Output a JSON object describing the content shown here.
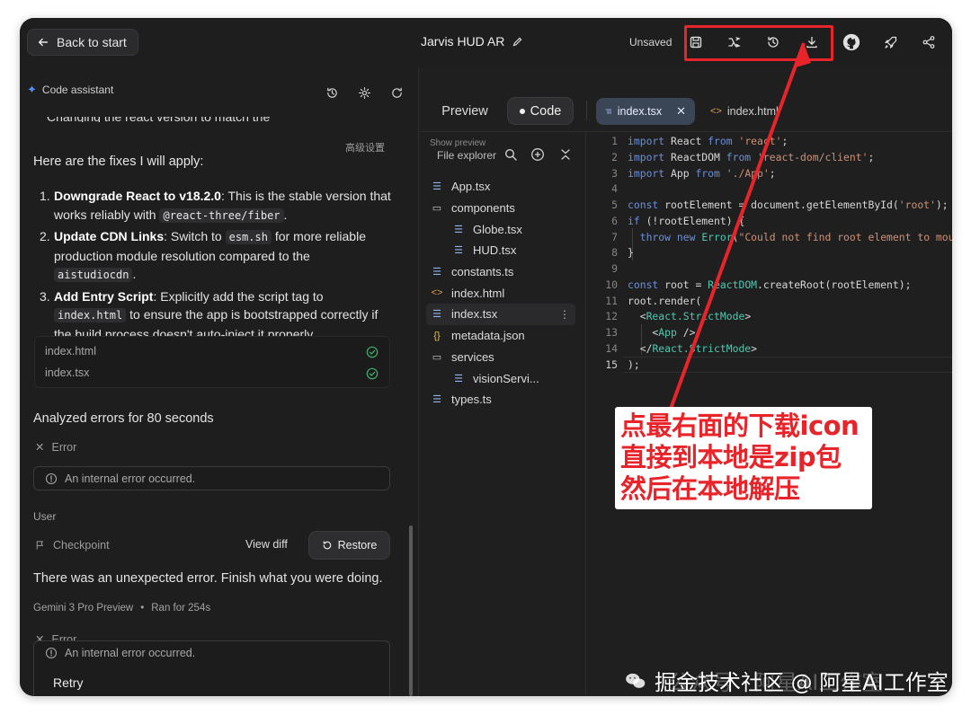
{
  "header": {
    "back_label": "Back to start",
    "title": "Jarvis HUD AR",
    "status": "Unsaved",
    "toolbar_icons": [
      "save-icon",
      "share-icon",
      "history-icon",
      "download-icon"
    ],
    "right_icons": [
      "github-icon",
      "deploy-icon",
      "share-nodes-icon"
    ]
  },
  "assistant": {
    "title": "Code assistant",
    "advanced_settings": "高级设置",
    "intro": "Here are the fixes I will apply:",
    "fixes": [
      {
        "num": "1.",
        "bold": "Downgrade React to v18.2.0",
        "text1": ": This is the stable version that works reliably with ",
        "code1": "@react-three/fiber",
        "text2": "."
      },
      {
        "num": "2.",
        "bold": "Update CDN Links",
        "text1": ": Switch to ",
        "code1": "esm.sh",
        "text2": " for more reliable production module resolution compared to the ",
        "code2": "aistudiocdn",
        "text3": "."
      },
      {
        "num": "3.",
        "bold": "Add Entry Script",
        "text1": ": Explicitly add the script tag to ",
        "code1": "index.html",
        "text2": " to ensure the app is bootstrapped correctly if the build process doesn't auto-inject it properly."
      }
    ],
    "changed_files": [
      "index.html",
      "index.tsx"
    ],
    "analyzed": "Analyzed errors for 80 seconds",
    "error_label": "Error",
    "error_message": "An internal error occurred.",
    "user_label": "User",
    "checkpoint_label": "Checkpoint",
    "view_diff": "View diff",
    "restore": "Restore",
    "user_message": "There was an unexpected error. Finish what you were doing.",
    "model": "Gemini 3 Pro Preview",
    "ran_for": "Ran for 254s",
    "retry": "Retry"
  },
  "editor_panel": {
    "tab_preview": "Preview",
    "tab_code": "Code",
    "open_files": [
      "index.tsx",
      "index.html"
    ],
    "show_preview": "Show preview",
    "explorer_title": "File explorer",
    "files": [
      {
        "name": "App.tsx",
        "icon": "file-lines-icon",
        "indent": 0
      },
      {
        "name": "components",
        "icon": "folder-icon",
        "indent": 0
      },
      {
        "name": "Globe.tsx",
        "icon": "file-lines-icon",
        "indent": 1
      },
      {
        "name": "HUD.tsx",
        "icon": "file-lines-icon",
        "indent": 1
      },
      {
        "name": "constants.ts",
        "icon": "file-lines-icon",
        "indent": 0
      },
      {
        "name": "index.html",
        "icon": "html-icon",
        "indent": 0
      },
      {
        "name": "index.tsx",
        "icon": "file-lines-icon",
        "indent": 0,
        "selected": true
      },
      {
        "name": "metadata.json",
        "icon": "json-icon",
        "indent": 0
      },
      {
        "name": "services",
        "icon": "folder-icon",
        "indent": 0
      },
      {
        "name": "visionServi...",
        "icon": "file-lines-icon",
        "indent": 1
      },
      {
        "name": "types.ts",
        "icon": "file-lines-icon",
        "indent": 0
      }
    ],
    "code_lines": [
      [
        [
          "kw",
          "import"
        ],
        [
          "p",
          " React "
        ],
        [
          "kw",
          "from"
        ],
        [
          "p",
          " "
        ],
        [
          "str",
          "'react'"
        ],
        [
          "p",
          ";"
        ]
      ],
      [
        [
          "kw",
          "import"
        ],
        [
          "p",
          " ReactDOM "
        ],
        [
          "kw",
          "from"
        ],
        [
          "p",
          " "
        ],
        [
          "str",
          "'react-dom/client'"
        ],
        [
          "p",
          ";"
        ]
      ],
      [
        [
          "kw",
          "import"
        ],
        [
          "p",
          " App "
        ],
        [
          "kw",
          "from"
        ],
        [
          "p",
          " "
        ],
        [
          "str",
          "'./App'"
        ],
        [
          "p",
          ";"
        ]
      ],
      [],
      [
        [
          "kw",
          "const"
        ],
        [
          "p",
          " rootElement = document.getElementById("
        ],
        [
          "str",
          "'root'"
        ],
        [
          "p",
          ");"
        ]
      ],
      [
        [
          "kw",
          "if"
        ],
        [
          "p",
          " (!rootElement) {"
        ]
      ],
      [
        [
          "p",
          "  "
        ],
        [
          "kw",
          "throw"
        ],
        [
          "p",
          " "
        ],
        [
          "kw",
          "new"
        ],
        [
          "p",
          " "
        ],
        [
          "fn",
          "Error"
        ],
        [
          "p",
          "("
        ],
        [
          "str",
          "\"Could not find root element to mount to\""
        ],
        [
          "p",
          ");"
        ]
      ],
      [
        [
          "p",
          "}"
        ]
      ],
      [],
      [
        [
          "kw",
          "const"
        ],
        [
          "p",
          " root = "
        ],
        [
          "fn",
          "ReactDOM"
        ],
        [
          "p",
          ".createRoot(rootElement);"
        ]
      ],
      [
        [
          "p",
          "root.render("
        ]
      ],
      [
        [
          "p",
          "  <"
        ],
        [
          "tag",
          "React.StrictMode"
        ],
        [
          "p",
          ">"
        ]
      ],
      [
        [
          "p",
          "    <"
        ],
        [
          "tag",
          "App"
        ],
        [
          "p",
          " />"
        ]
      ],
      [
        [
          "p",
          "  </"
        ],
        [
          "tag",
          "React.StrictMode"
        ],
        [
          "p",
          ">"
        ]
      ],
      [
        [
          "p",
          ");"
        ]
      ]
    ]
  },
  "annotation": {
    "lines": [
      "点最右面的下载icon",
      "直接到本地是zip包",
      "然后在本地解压"
    ]
  },
  "watermark": {
    "faded": "公众号 · 阿星AI工作室",
    "text": "掘金技术社区 @ 阿星AI工作室"
  },
  "colors": {
    "background": "#1e1e1f",
    "accent_blue": "#4f8ff7",
    "annotation_red": "#e8242b",
    "check_green": "#3fae6a",
    "keyword": "#6b8fd6",
    "string": "#ce9178",
    "tag": "#4ec9b0"
  }
}
